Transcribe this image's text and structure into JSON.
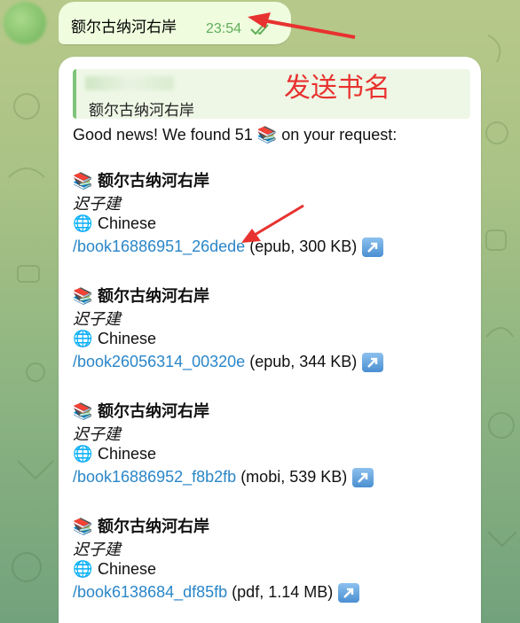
{
  "outgoing": {
    "text": "额尔古纳河右岸",
    "time": "23:54"
  },
  "incoming": {
    "reply_quote": "额尔古纳河右岸",
    "annotation": "发送书名",
    "intro": "Good news! We found 51 📚 on your request:",
    "books": [
      {
        "icon": "📚",
        "title": "额尔古纳河右岸",
        "author": "迟子建",
        "lang_icon": "🌐",
        "language": "Chinese",
        "link": "/book16886951_26dede",
        "meta": " (epub, 300 KB)"
      },
      {
        "icon": "📚",
        "title": "额尔古纳河右岸",
        "author": "迟子建",
        "lang_icon": "🌐",
        "language": "Chinese",
        "link": "/book26056314_00320e",
        "meta": " (epub, 344 KB)"
      },
      {
        "icon": "📚",
        "title": "额尔古纳河右岸",
        "author": "迟子建",
        "lang_icon": "🌐",
        "language": "Chinese",
        "link": "/book16886952_f8b2fb",
        "meta": " (mobi, 539 KB)"
      },
      {
        "icon": "📚",
        "title": "额尔古纳河右岸",
        "author": "迟子建",
        "lang_icon": "🌐",
        "language": "Chinese",
        "link": "/book6138684_df85fb",
        "meta": " (pdf, 1.14 MB)"
      }
    ]
  },
  "colors": {
    "link": "#2a86c8",
    "annotation": "#e8322f",
    "out_bubble": "#effdde",
    "check": "#5fae5a"
  }
}
